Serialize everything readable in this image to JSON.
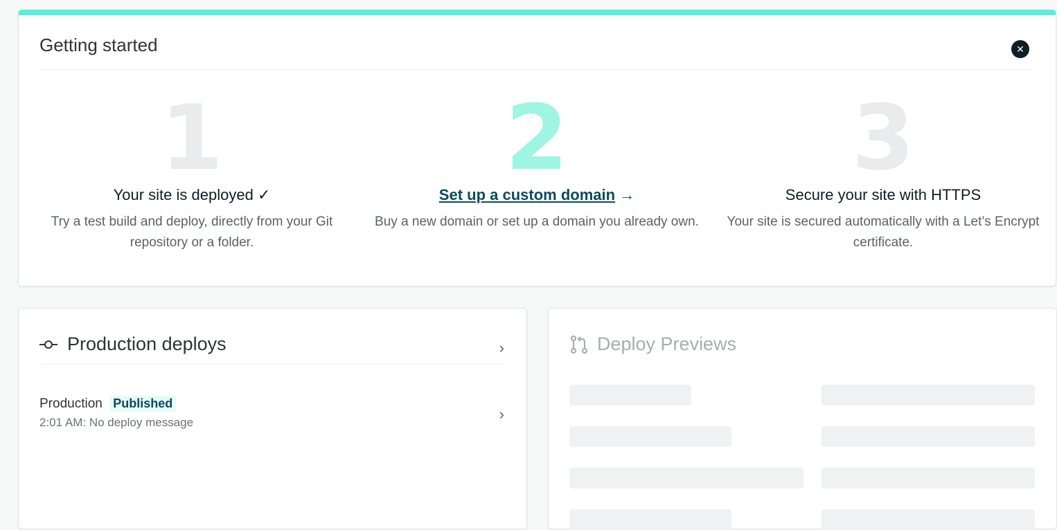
{
  "getting_started": {
    "title": "Getting started",
    "close_icon": "close-icon",
    "steps": [
      {
        "number": "1",
        "title": "Your site is deployed ✓",
        "description": "Try a test build and deploy, directly from your Git repository or a folder."
      },
      {
        "number": "2",
        "title": "Set up a custom domain",
        "arrow": "→",
        "description": "Buy a new domain or set up a domain you already own."
      },
      {
        "number": "3",
        "title": "Secure your site with HTTPS",
        "description": "Your site is secured automatically with a Let’s Encrypt certificate."
      }
    ]
  },
  "production_deploys": {
    "title": "Production deploys",
    "icon": "commit-icon",
    "deploy": {
      "name": "Production",
      "badge": "Published",
      "meta": "2:01 AM: No deploy message"
    }
  },
  "deploy_previews": {
    "title": "Deploy Previews",
    "icon": "pull-request-icon"
  },
  "colors": {
    "accent": "#5ceddb",
    "active_step": "#9df5e2",
    "link": "#0b4a5e"
  }
}
